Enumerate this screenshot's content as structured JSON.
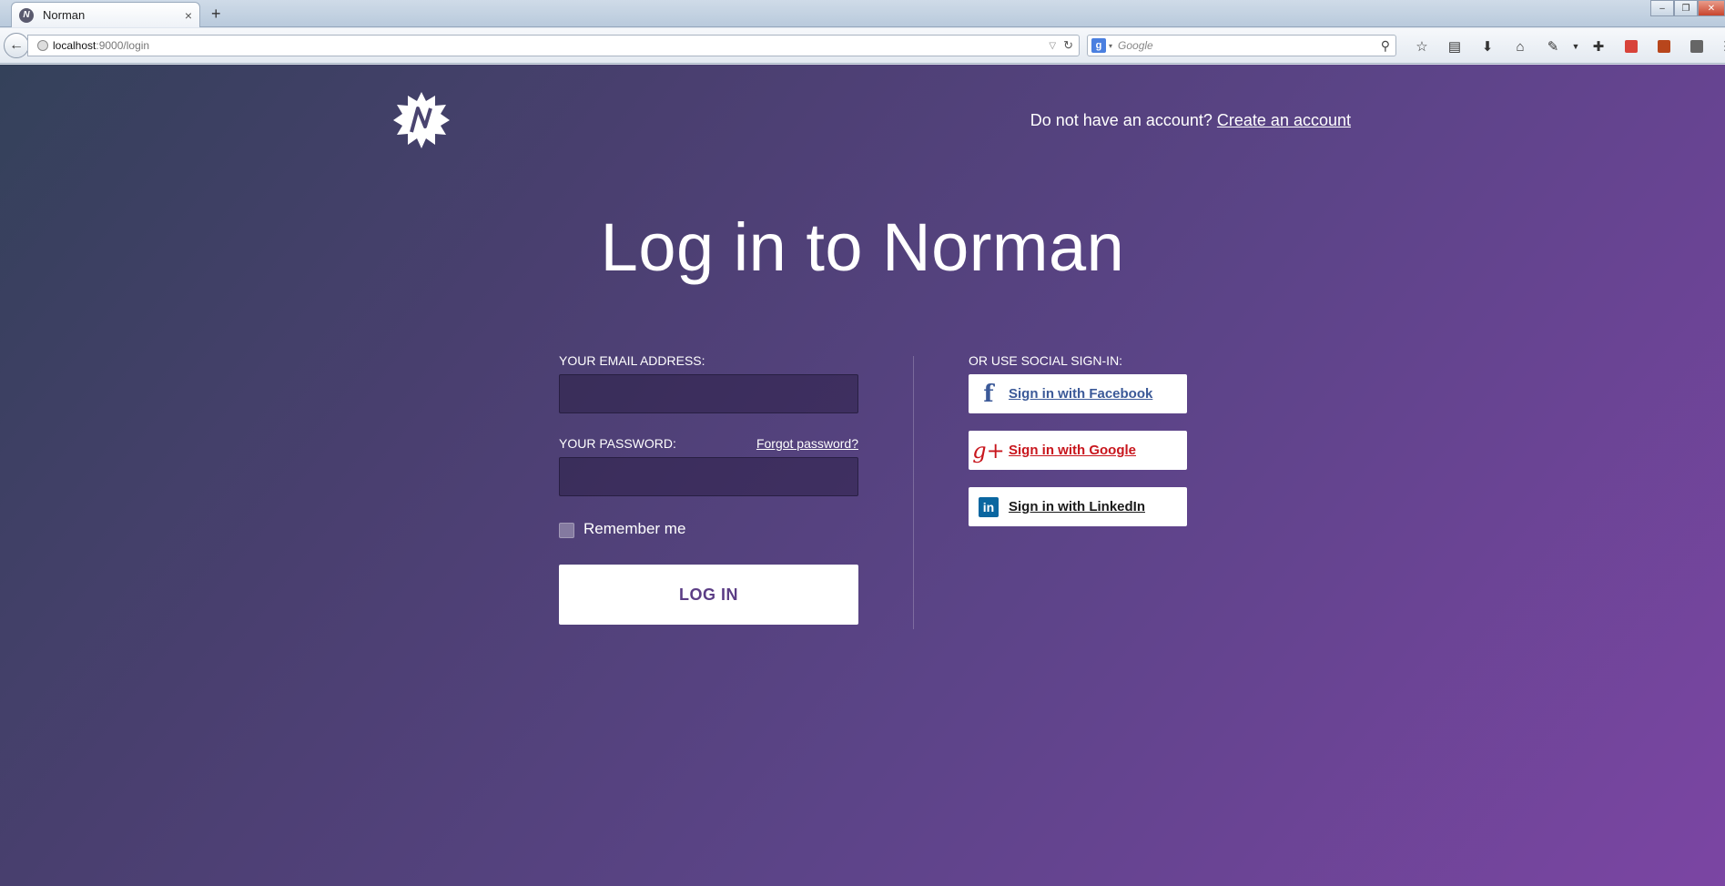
{
  "browser": {
    "tab_title": "Norman",
    "tab_close": "×",
    "new_tab": "+",
    "url_host": "localhost",
    "url_path": ":9000/login",
    "search_placeholder": "Google",
    "icons": [
      "bookmark-star-icon",
      "reading-list-icon",
      "download-icon",
      "home-icon",
      "extension-icon",
      "menu-dropdown-icon",
      "addon-icon",
      "addon-red-icon",
      "addon-orange-icon",
      "addon-grey-icon",
      "hamburger-menu-icon"
    ]
  },
  "header": {
    "prompt_text": "Do not have an account?",
    "create_account": "Create an account"
  },
  "main": {
    "title": "Log in to Norman"
  },
  "form": {
    "email_label": "YOUR EMAIL ADDRESS:",
    "password_label": "YOUR PASSWORD:",
    "forgot_password": "Forgot password?",
    "remember_me": "Remember me",
    "login_button": "LOG IN"
  },
  "social": {
    "heading": "OR USE SOCIAL SIGN-IN:",
    "facebook": "Sign in with Facebook",
    "google": "Sign in with Google",
    "linkedin": "Sign in with LinkedIn"
  },
  "colors": {
    "facebook": "#3b5998",
    "google": "#c8161d",
    "linkedin": "#0a66a0",
    "button_text": "#5b3d85"
  }
}
